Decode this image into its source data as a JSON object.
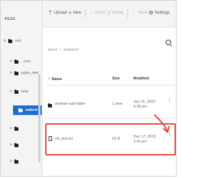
{
  "sidebar": {
    "title": "FILES",
    "items": [
      {
        "label": "root",
        "chevron": "v"
      },
      {
        "label": "...com",
        "chevron": ">"
      },
      {
        "label": "public_html",
        "chevron": ">"
      },
      {
        "label": "tests",
        "chevron": ">"
      },
      {
        "label": "subtest",
        "chevron": ">"
      },
      {
        "label": "",
        "chevron": ">"
      },
      {
        "label": "",
        "chevron": ">"
      },
      {
        "label": "",
        "chevron": ">"
      }
    ]
  },
  "toolbar": {
    "upload_label": "Upload",
    "new_label": "New",
    "move_label": "Move",
    "delete_label": "Delete",
    "more_label": "More",
    "settings_label": "Settings"
  },
  "breadcrumb": {
    "root": "ROOT",
    "separator": "/",
    "current": "SUBTEST"
  },
  "table": {
    "headers": {
      "name": "Name",
      "size": "Size",
      "modified": "Modified"
    },
    "rows": [
      {
        "name": "another-sub-folder",
        "size": "1 item",
        "modified": "Jan 15, 2020 5:36 pm",
        "type": "folder"
      },
      {
        "name": "cfx_test.txt",
        "size": "62 B",
        "modified": "Dec 17, 2019 1:41 pm",
        "type": "file"
      }
    ]
  },
  "colors": {
    "selected": "#1f6ed4",
    "highlight": "#e0473f"
  }
}
